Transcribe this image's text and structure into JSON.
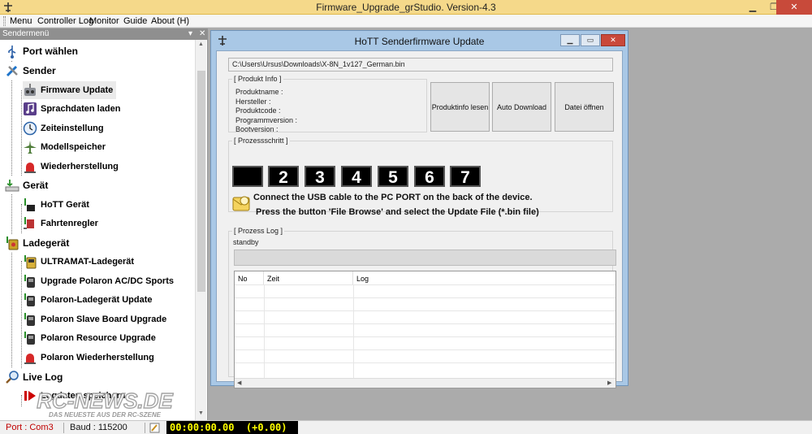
{
  "window": {
    "title": "Firmware_Upgrade_grStudio.   Version-4.3",
    "icons": {
      "app": "airplane-icon",
      "minimize": "minimize-icon",
      "restore": "restore-icon",
      "close": "close-icon"
    }
  },
  "menubar": {
    "items": [
      "Menu",
      "Controller Log",
      "Monitor",
      "Guide",
      "About (H)"
    ]
  },
  "sidebar": {
    "header": "Sendermenü",
    "header_icons": [
      "pin-icon",
      "close-icon"
    ],
    "items": [
      {
        "label": "Port wählen",
        "icon": "usb-icon",
        "level": 0
      },
      {
        "label": "Sender",
        "icon": "tools-icon",
        "level": 0
      },
      {
        "label": "Firmware Update",
        "icon": "transmitter-icon",
        "level": 1,
        "selected": true
      },
      {
        "label": "Sprachdaten laden",
        "icon": "music-note-icon",
        "level": 1
      },
      {
        "label": "Zeiteinstellung",
        "icon": "clock-icon",
        "level": 1
      },
      {
        "label": "Modellspeicher",
        "icon": "airplane-icon",
        "level": 1
      },
      {
        "label": "Wiederherstellung",
        "icon": "alarm-light-icon",
        "level": 1
      },
      {
        "label": "Gerät",
        "icon": "device-download-icon",
        "level": 0
      },
      {
        "label": "HoTT Gerät",
        "icon": "receiver-icon",
        "level": 1
      },
      {
        "label": "Fahrtenregler",
        "icon": "speed-controller-icon",
        "level": 1
      },
      {
        "label": "Ladegerät",
        "icon": "charger-icon",
        "level": 0
      },
      {
        "label": "ULTRAMAT-Ladegerät",
        "icon": "charger-icon",
        "level": 1
      },
      {
        "label": "Upgrade Polaron AC/DC Sports",
        "icon": "charger-icon",
        "level": 1
      },
      {
        "label": "Polaron-Ladegerät Update",
        "icon": "charger-icon",
        "level": 1
      },
      {
        "label": "Polaron Slave Board Upgrade",
        "icon": "charger-icon",
        "level": 1
      },
      {
        "label": "Polaron Resource Upgrade",
        "icon": "charger-icon",
        "level": 1
      },
      {
        "label": "Polaron Wiederherstellung",
        "icon": "alarm-light-icon",
        "level": 1
      },
      {
        "label": "Live Log",
        "icon": "magnifier-icon",
        "level": 0
      },
      {
        "label": "Logdaten speichern",
        "icon": "record-icon",
        "level": 1
      }
    ]
  },
  "watermark": {
    "brand": "RC-NEWS.DE",
    "tagline": "DAS NEUESTE AUS DER RC-SZENE"
  },
  "dialog": {
    "title": "HoTT Senderfirmware Update",
    "file_path": "C:\\Users\\Ursus\\Downloads\\X-8N_1v127_German.bin",
    "product_info": {
      "label": "[ Produkt Info ]",
      "fields": [
        "Produktname :",
        "Hersteller :",
        "Produktcode :",
        "Programmversion :",
        "Bootversion :"
      ]
    },
    "buttons": {
      "product_info": "Produktinfo lesen",
      "auto_download": "Auto Download",
      "open_file": "Datei öffnen"
    },
    "steps": {
      "label": "[ Prozessschritt ]",
      "values": [
        "",
        "2",
        "3",
        "4",
        "5",
        "6",
        "7"
      ]
    },
    "instructions": {
      "line1": "Connect the USB cable to the PC PORT on the back of the device.",
      "line2": "Press the button 'File Browse' and select the Update File (*.bin file)"
    },
    "process_log": {
      "label": "[ Prozess Log ]",
      "status": "standby",
      "progress": 0,
      "columns": [
        "No",
        "Zeit",
        "Log"
      ],
      "rows": []
    }
  },
  "statusbar": {
    "port": "Port : Com3",
    "baud": "Baud : 115200",
    "timer": "00:00:00.00  (+0.00)"
  },
  "colors": {
    "titlebar": "#f5d98a",
    "close_button": "#c84a3a",
    "dialog_frame": "#a9c8e6",
    "mdi_background": "#ababab",
    "port_text": "#c00000",
    "timer_text": "#ffff00"
  }
}
